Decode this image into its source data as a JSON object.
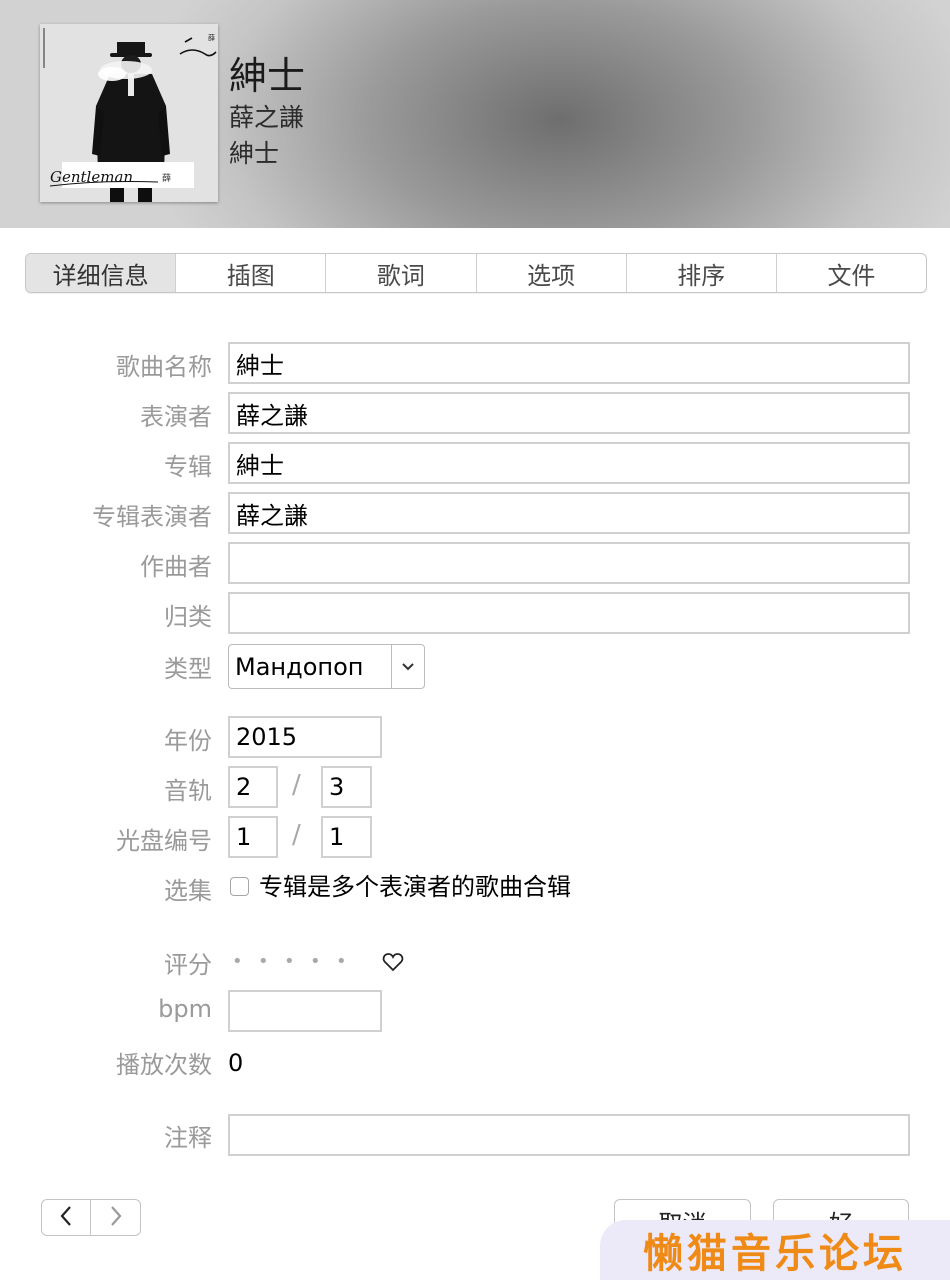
{
  "header": {
    "song_title": "紳士",
    "artist": "薛之謙",
    "album": "紳士",
    "artwork": {
      "script_text": "Gentleman",
      "stamp_text": "薛"
    }
  },
  "tabs": [
    {
      "label": "详细信息",
      "active": true
    },
    {
      "label": "插图",
      "active": false
    },
    {
      "label": "歌词",
      "active": false
    },
    {
      "label": "选项",
      "active": false
    },
    {
      "label": "排序",
      "active": false
    },
    {
      "label": "文件",
      "active": false
    }
  ],
  "form": {
    "song_name": {
      "label": "歌曲名称",
      "value": "紳士"
    },
    "artist": {
      "label": "表演者",
      "value": "薛之謙"
    },
    "album": {
      "label": "专辑",
      "value": "紳士"
    },
    "album_artist": {
      "label": "专辑表演者",
      "value": "薛之謙"
    },
    "composer": {
      "label": "作曲者",
      "value": ""
    },
    "grouping": {
      "label": "归类",
      "value": ""
    },
    "genre": {
      "label": "类型",
      "value": "Мандопоп"
    },
    "year": {
      "label": "年份",
      "value": "2015"
    },
    "track": {
      "label": "音轨",
      "number": "2",
      "total": "3",
      "separator": "/"
    },
    "disc": {
      "label": "光盘编号",
      "number": "1",
      "total": "1",
      "separator": "/"
    },
    "compilation": {
      "label": "选集",
      "checkbox_label": "专辑是多个表演者的歌曲合辑",
      "checked": false
    },
    "rating": {
      "label": "评分",
      "stars": 0,
      "max": 5,
      "dot": "•",
      "loved": false
    },
    "bpm": {
      "label": "bpm",
      "value": ""
    },
    "play_count": {
      "label": "播放次数",
      "value": "0"
    },
    "comments": {
      "label": "注释",
      "value": ""
    }
  },
  "buttons": {
    "cancel": "取消",
    "ok": "好",
    "prev_icon": "chevron-left-icon",
    "next_icon": "chevron-right-icon"
  },
  "watermark": "懒猫音乐论坛",
  "colors": {
    "label": "#9a9a9a",
    "field_border": "#d0d0d0",
    "watermark_text": "#f08a16",
    "watermark_bg": "#eceaf9"
  }
}
